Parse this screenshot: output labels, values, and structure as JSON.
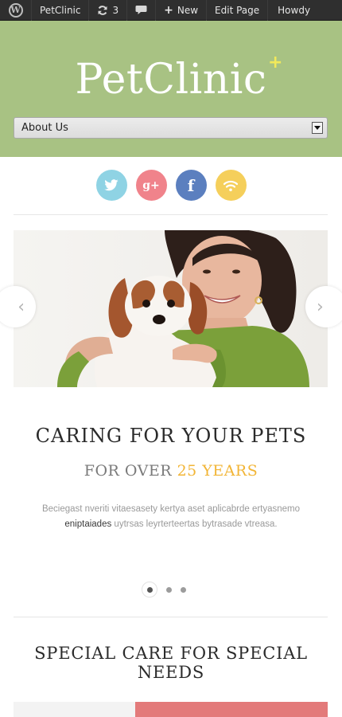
{
  "adminbar": {
    "wp_logo": "W",
    "site_name": "PetClinic",
    "updates_count": "3",
    "new_label": "New",
    "new_icon": "+",
    "edit_label": "Edit Page",
    "howdy": "Howdy"
  },
  "header": {
    "logo": "PetClinic",
    "logo_plus": "+",
    "menu_selected": "About Us",
    "bg_color": "#a8c283"
  },
  "social": {
    "google_label": "g+",
    "facebook_label": "f",
    "icons": [
      "twitter-icon",
      "google-plus-icon",
      "facebook-icon",
      "rss-icon"
    ]
  },
  "slider": {
    "title": "CARING FOR YOUR PETS",
    "subtitle_prefix": "FOR OVER",
    "subtitle_accent": "25 YEARS",
    "text_part1": "Beciegast nveriti vitaesasety kertya aset aplicabrde ertyasnemo",
    "text_strong": "eniptaiades",
    "text_part2": "uytrsas leyrterteertas bytrasade vtreasa.",
    "prev_arrow": "‹",
    "next_arrow": "›",
    "accent_color": "#f2b536"
  },
  "section": {
    "title": "SPECIAL CARE FOR SPECIAL NEEDS"
  }
}
